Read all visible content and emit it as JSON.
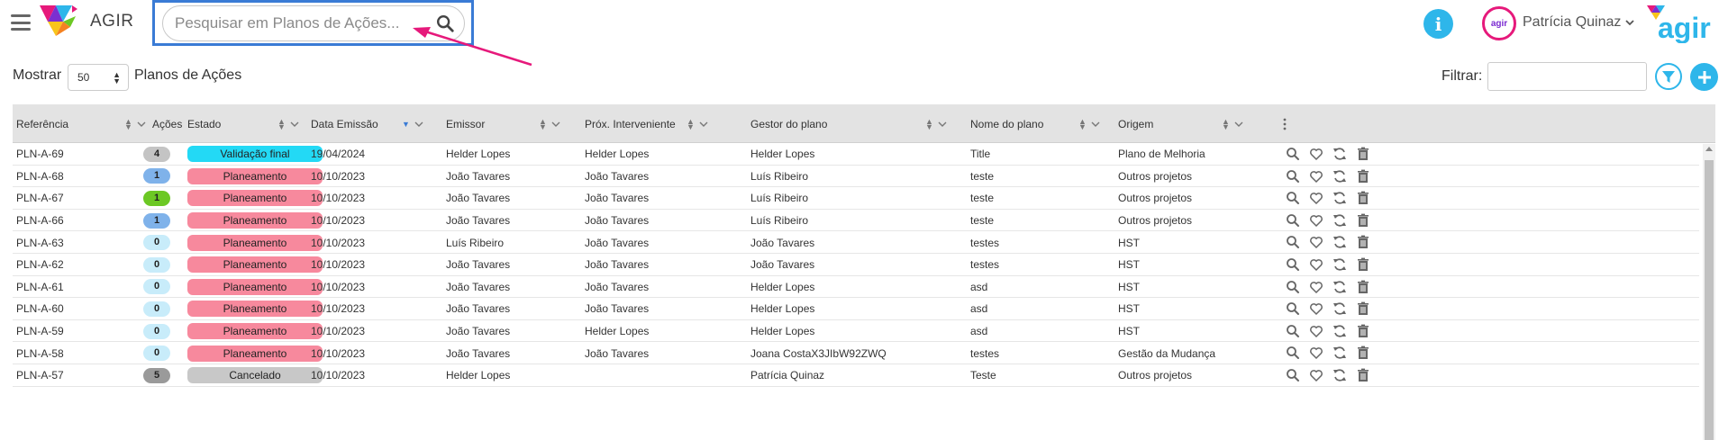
{
  "header": {
    "app_title": "AGIR",
    "search": {
      "placeholder": "Pesquisar em Planos de Ações..."
    },
    "user": {
      "name": "Patrícia Quinaz",
      "avatar_text": "agir"
    },
    "brand": "agir"
  },
  "toolbar": {
    "show_label": "Mostrar",
    "page_size": "50",
    "plans_label": "Planos de Ações",
    "filter_label": "Filtrar:",
    "filter_value": ""
  },
  "table": {
    "columns": [
      {
        "label": "Referência"
      },
      {
        "label": "Ações"
      },
      {
        "label": "Estado"
      },
      {
        "label": "Data Emissão"
      },
      {
        "label": "Emissor"
      },
      {
        "label": "Próx. Interveniente"
      },
      {
        "label": "Gestor do plano"
      },
      {
        "label": "Nome do plano"
      },
      {
        "label": "Origem"
      }
    ],
    "rows": [
      {
        "ref": "PLN-A-69",
        "actions": "4",
        "actions_color": "#c4c4c4",
        "state": "Validação final",
        "state_color": "#23d9f5",
        "date": "19/04/2024",
        "issuer": "Helder Lopes",
        "next": "Helder Lopes",
        "manager": "Helder Lopes",
        "plan": "Title",
        "origin": "Plano de Melhoria"
      },
      {
        "ref": "PLN-A-68",
        "actions": "1",
        "actions_color": "#7fb2ea",
        "state": "Planeamento",
        "state_color": "#f7899d",
        "date": "10/10/2023",
        "issuer": "João Tavares",
        "next": "João Tavares",
        "manager": "Luís Ribeiro",
        "plan": "teste",
        "origin": "Outros projetos"
      },
      {
        "ref": "PLN-A-67",
        "actions": "1",
        "actions_color": "#6cc824",
        "state": "Planeamento",
        "state_color": "#f7899d",
        "date": "10/10/2023",
        "issuer": "João Tavares",
        "next": "João Tavares",
        "manager": "Luís Ribeiro",
        "plan": "teste",
        "origin": "Outros projetos"
      },
      {
        "ref": "PLN-A-66",
        "actions": "1",
        "actions_color": "#7fb2ea",
        "state": "Planeamento",
        "state_color": "#f7899d",
        "date": "10/10/2023",
        "issuer": "João Tavares",
        "next": "João Tavares",
        "manager": "Luís Ribeiro",
        "plan": "teste",
        "origin": "Outros projetos"
      },
      {
        "ref": "PLN-A-63",
        "actions": "0",
        "actions_color": "#c8ecfa",
        "state": "Planeamento",
        "state_color": "#f7899d",
        "date": "10/10/2023",
        "issuer": "Luís Ribeiro",
        "next": "João Tavares",
        "manager": "João Tavares",
        "plan": "testes",
        "origin": "HST"
      },
      {
        "ref": "PLN-A-62",
        "actions": "0",
        "actions_color": "#c8ecfa",
        "state": "Planeamento",
        "state_color": "#f7899d",
        "date": "10/10/2023",
        "issuer": "João Tavares",
        "next": "João Tavares",
        "manager": "João Tavares",
        "plan": "testes",
        "origin": "HST"
      },
      {
        "ref": "PLN-A-61",
        "actions": "0",
        "actions_color": "#c8ecfa",
        "state": "Planeamento",
        "state_color": "#f7899d",
        "date": "10/10/2023",
        "issuer": "João Tavares",
        "next": "João Tavares",
        "manager": "Helder Lopes",
        "plan": "asd",
        "origin": "HST"
      },
      {
        "ref": "PLN-A-60",
        "actions": "0",
        "actions_color": "#c8ecfa",
        "state": "Planeamento",
        "state_color": "#f7899d",
        "date": "10/10/2023",
        "issuer": "João Tavares",
        "next": "João Tavares",
        "manager": "Helder Lopes",
        "plan": "asd",
        "origin": "HST"
      },
      {
        "ref": "PLN-A-59",
        "actions": "0",
        "actions_color": "#c8ecfa",
        "state": "Planeamento",
        "state_color": "#f7899d",
        "date": "10/10/2023",
        "issuer": "João Tavares",
        "next": "Helder Lopes",
        "manager": "Helder Lopes",
        "plan": "asd",
        "origin": "HST"
      },
      {
        "ref": "PLN-A-58",
        "actions": "0",
        "actions_color": "#c8ecfa",
        "state": "Planeamento",
        "state_color": "#f7899d",
        "date": "10/10/2023",
        "issuer": "João Tavares",
        "next": "João Tavares",
        "manager": "Joana CostaX3JIbW92ZWQ",
        "plan": "testes",
        "origin": "Gestão da Mudança"
      },
      {
        "ref": "PLN-A-57",
        "actions": "5",
        "actions_color": "#9a9a9a",
        "state": "Cancelado",
        "state_color": "#c8c8c8",
        "date": "10/10/2023",
        "issuer": "Helder Lopes",
        "next": "",
        "manager": "Patrícia Quinaz",
        "plan": "Teste",
        "origin": "Outros projetos"
      }
    ]
  },
  "colors": {
    "accent": "#2eb6ea",
    "header_bg": "#e3e3e3",
    "highlight_border": "#3a7bd5",
    "annotation_arrow": "#e6197b"
  },
  "icons": [
    "menu-icon",
    "search-icon",
    "info-icon",
    "chevron-down-icon",
    "filter-icon",
    "plus-icon",
    "view-icon",
    "favorite-icon",
    "refresh-icon",
    "delete-icon"
  ]
}
